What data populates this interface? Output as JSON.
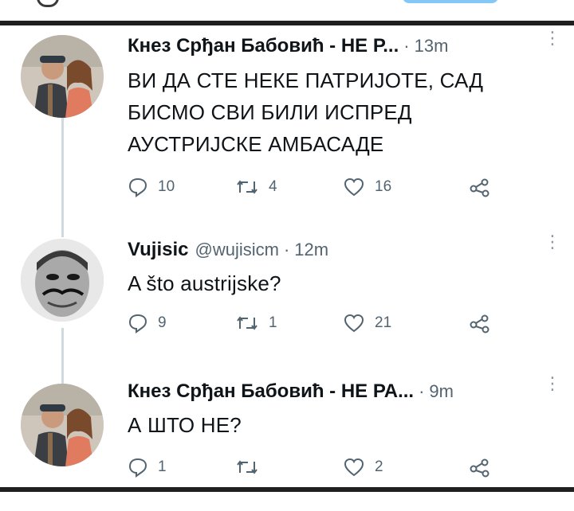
{
  "tweets": [
    {
      "name": "Кнез Срђан Бабовић - НЕ Р...",
      "handle": "",
      "time": "13m",
      "text_lines": [
        "ВИ ДА СТЕ НЕКЕ ПАТРИЈОТЕ, САД",
        "БИСМО СВИ БИЛИ ИСПРЕД",
        "АУСТРИЈСКЕ АМБАСАДЕ"
      ],
      "replies": "10",
      "retweets": "4",
      "likes": "16"
    },
    {
      "name": "Vujisic",
      "handle": "@wujisicm",
      "time": "12m",
      "text_lines": [
        "A što austrijske?"
      ],
      "replies": "9",
      "retweets": "1",
      "likes": "21"
    },
    {
      "name": "Кнез Срђан Бабовић - НЕ РА...",
      "handle": "",
      "time": "9m",
      "text_lines": [
        "А ШТО НЕ?"
      ],
      "replies": "1",
      "retweets": "",
      "likes": "2"
    }
  ],
  "icons": {
    "reply": "reply-icon",
    "retweet": "retweet-icon",
    "like": "heart-icon",
    "share": "share-icon",
    "more": "more-icon"
  },
  "colors": {
    "text": "#0f1419",
    "muted": "#536471",
    "thread": "#cfd9de",
    "frame": "#1f1f1f"
  }
}
